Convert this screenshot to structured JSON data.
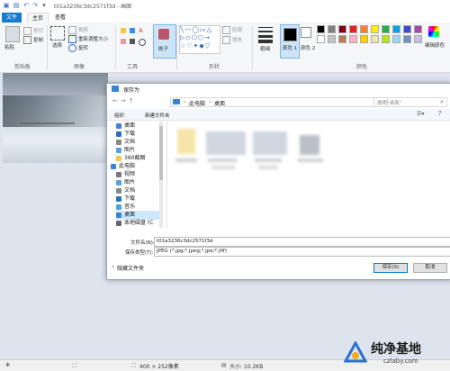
{
  "window": {
    "title": "t01a3236c3dc2571f3d - 画图"
  },
  "tabs": {
    "file": "文件",
    "home": "主页",
    "view": "查看"
  },
  "ribbon": {
    "clipboard": {
      "label": "剪贴板",
      "paste": "粘贴",
      "cut": "剪切",
      "copy": "复制"
    },
    "image": {
      "label": "图像",
      "select": "选择",
      "crop": "裁剪",
      "resize": "重新调整大小",
      "rotate": "旋转"
    },
    "tools": {
      "label": "工具"
    },
    "brushes": {
      "label": "刷子"
    },
    "shapes": {
      "label": "形状",
      "outline": "轮廓",
      "fill": "填充"
    },
    "size": {
      "label": "粗细"
    },
    "color1": "颜色 1",
    "color2": "颜色 2",
    "colors": {
      "label": "颜色",
      "edit": "编辑颜色"
    },
    "palette": [
      "#000000",
      "#7f7f7f",
      "#880015",
      "#ed1c24",
      "#ff7f27",
      "#fff200",
      "#22b14c",
      "#00a2e8",
      "#3f48cc",
      "#a349a4",
      "#ffffff",
      "#c3c3c3",
      "#b97a57",
      "#ffaec9",
      "#ffc90e",
      "#efe4b0",
      "#b5e61d",
      "#99d9ea",
      "#7092be",
      "#c8bfe7"
    ]
  },
  "dialog": {
    "title": "保存为",
    "breadcrumb_pc": "此电脑",
    "breadcrumb_desktop": "桌面",
    "search_placeholder": "搜索\"桌面\"",
    "organize": "组织",
    "new_folder": "新建文件夹",
    "nav": [
      "桌面",
      "下载",
      "文档",
      "图片",
      "360截图",
      "此电脑",
      "视频",
      "图片",
      "文档",
      "下载",
      "音乐",
      "桌面",
      "本地磁盘 (C"
    ],
    "filename_label": "文件名(N):",
    "filename_value": "t01a3236c3dc2571f3d",
    "filetype_label": "保存类型(T):",
    "filetype_value": "JPEG (*.jpg;*.jpeg;*.jpe;*.jfif)",
    "hide_folders": "隐藏文件夹",
    "save": "保存(S)",
    "cancel": "取消"
  },
  "status": {
    "dimensions": "400 × 252像素",
    "size": "大小: 10.2KB"
  },
  "watermark": {
    "name": "纯净基地",
    "url": "czlaby.com"
  }
}
